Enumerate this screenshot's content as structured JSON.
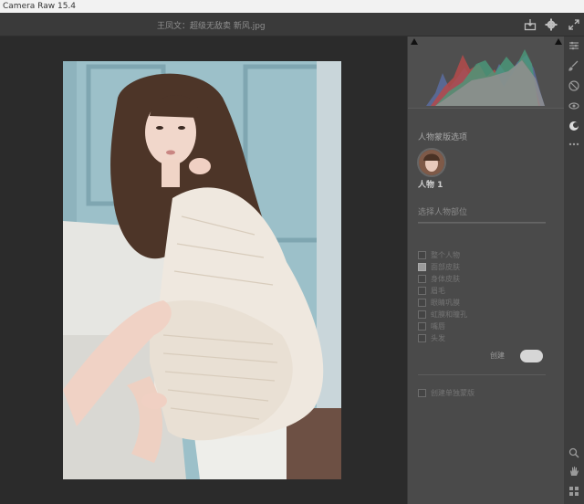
{
  "window": {
    "title": "Camera Raw 15.4"
  },
  "header": {
    "filename": "王凤文：超级无敌卖 新风.jpg"
  },
  "toolbar": {
    "save_icon": "download-icon",
    "settings_icon": "gear-icon",
    "expand_icon": "expand-icon"
  },
  "histogram": {
    "shadow_clip_icon": "shadow-clipping-icon",
    "highlight_clip_icon": "highlight-clipping-icon"
  },
  "panel": {
    "title": "人物蒙版选项",
    "person_label": "人物 1",
    "dropdown_value": "选择人物部位",
    "options": [
      {
        "label": "整个人物",
        "checked": false
      },
      {
        "label": "面部皮肤",
        "checked": true
      },
      {
        "label": "身体皮肤",
        "checked": false
      },
      {
        "label": "眉毛",
        "checked": false
      },
      {
        "label": "眼睛巩膜",
        "checked": false
      },
      {
        "label": "虹膜和瞳孔",
        "checked": false
      },
      {
        "label": "嘴唇",
        "checked": false
      },
      {
        "label": "头发",
        "checked": false
      }
    ],
    "action_label": "创建",
    "separate_masks_label": "创建单独蒙版"
  },
  "sidebar_icons": [
    "edit-icon",
    "brush-icon",
    "heal-icon",
    "redeye-icon",
    "mask-icon",
    "more-icon"
  ],
  "bottom_icons": [
    "zoom-icon",
    "hand-icon",
    "grid-icon"
  ]
}
